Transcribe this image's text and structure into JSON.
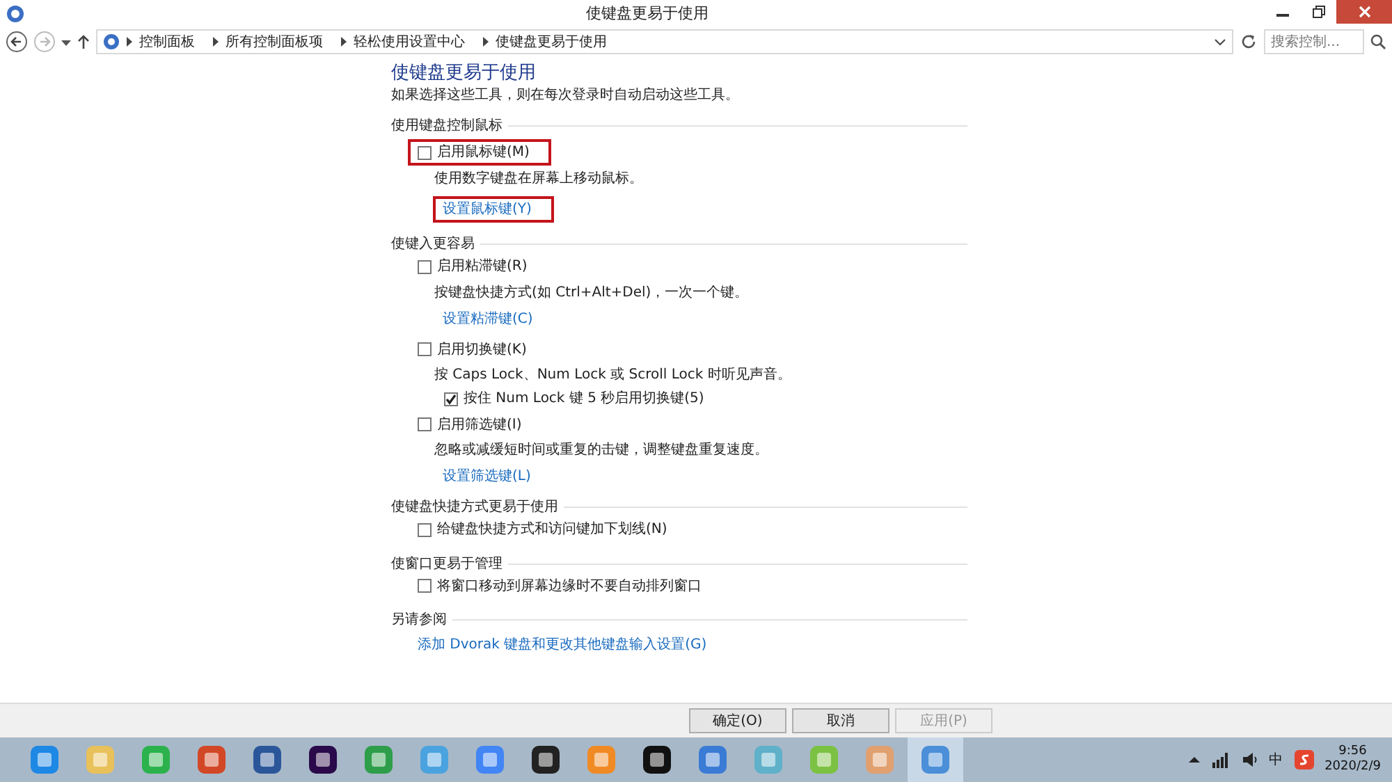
{
  "window": {
    "title": "使键盘更易于使用"
  },
  "address": {
    "crumbs": [
      "控制面板",
      "所有控制面板项",
      "轻松使用设置中心",
      "使键盘更易于使用"
    ],
    "search_placeholder": "搜索控制..."
  },
  "page": {
    "heading": "使键盘更易于使用",
    "intro": "如果选择这些工具，则在每次登录时自动启动这些工具。",
    "sections": [
      {
        "title": "使用键盘控制鼠标",
        "items": [
          {
            "kind": "checkbox",
            "label": "启用鼠标键(M)",
            "checked": false,
            "highlighted": true
          },
          {
            "kind": "note",
            "text": "使用数字键盘在屏幕上移动鼠标。"
          },
          {
            "kind": "link",
            "label": "设置鼠标键(Y)",
            "highlighted": true
          }
        ]
      },
      {
        "title": "使键入更容易",
        "items": [
          {
            "kind": "checkbox",
            "label": "启用粘滞键(R)",
            "checked": false
          },
          {
            "kind": "note",
            "text": "按键盘快捷方式(如 Ctrl+Alt+Del)，一次一个键。"
          },
          {
            "kind": "link",
            "label": "设置粘滞键(C)"
          },
          {
            "kind": "checkbox",
            "label": "启用切换键(K)",
            "checked": false
          },
          {
            "kind": "note",
            "text": "按 Caps Lock、Num Lock 或 Scroll Lock 时听见声音。"
          },
          {
            "kind": "subcheckbox",
            "label": "按住 Num Lock 键 5 秒启用切换键(5)",
            "checked": true
          },
          {
            "kind": "checkbox",
            "label": "启用筛选键(I)",
            "checked": false
          },
          {
            "kind": "note",
            "text": "忽略或减缓短时间或重复的击键，调整键盘重复速度。"
          },
          {
            "kind": "link",
            "label": "设置筛选键(L)"
          }
        ]
      },
      {
        "title": "使键盘快捷方式更易于使用",
        "items": [
          {
            "kind": "checkbox",
            "label": "给键盘快捷方式和访问键加下划线(N)",
            "checked": false
          }
        ]
      },
      {
        "title": "使窗口更易于管理",
        "items": [
          {
            "kind": "checkbox",
            "label": "将窗口移动到屏幕边缘时不要自动排列窗口",
            "checked": false
          }
        ]
      },
      {
        "title": "另请参阅",
        "items": [
          {
            "kind": "link",
            "label": "添加 Dvorak 键盘和更改其他键盘输入设置(G)"
          }
        ]
      }
    ]
  },
  "buttons": [
    {
      "label": "确定(O)",
      "disabled": false
    },
    {
      "label": "取消",
      "disabled": false
    },
    {
      "label": "应用(P)",
      "disabled": true
    }
  ],
  "taskbar": {
    "apps": [
      {
        "color": "#1e88e5",
        "selected": false
      },
      {
        "color": "#e8c15a",
        "selected": false
      },
      {
        "color": "#2bb24c",
        "selected": false
      },
      {
        "color": "#d24726",
        "selected": false
      },
      {
        "color": "#2b579a",
        "selected": false
      },
      {
        "color": "#2a0a4a",
        "selected": false
      },
      {
        "color": "#2e9e4a",
        "selected": false
      },
      {
        "color": "#4aa3df",
        "selected": false
      },
      {
        "color": "#4285f4",
        "selected": false
      },
      {
        "color": "#222222",
        "selected": false
      },
      {
        "color": "#f08a24",
        "selected": false
      },
      {
        "color": "#111111",
        "selected": false
      },
      {
        "color": "#3a7bd5",
        "selected": false
      },
      {
        "color": "#5fb0c9",
        "selected": false
      },
      {
        "color": "#7cc242",
        "selected": false
      },
      {
        "color": "#e0a070",
        "selected": false
      },
      {
        "color": "#4a8fd8",
        "selected": true
      }
    ],
    "ime": "中",
    "time": "9:56",
    "date": "2020/2/9"
  }
}
